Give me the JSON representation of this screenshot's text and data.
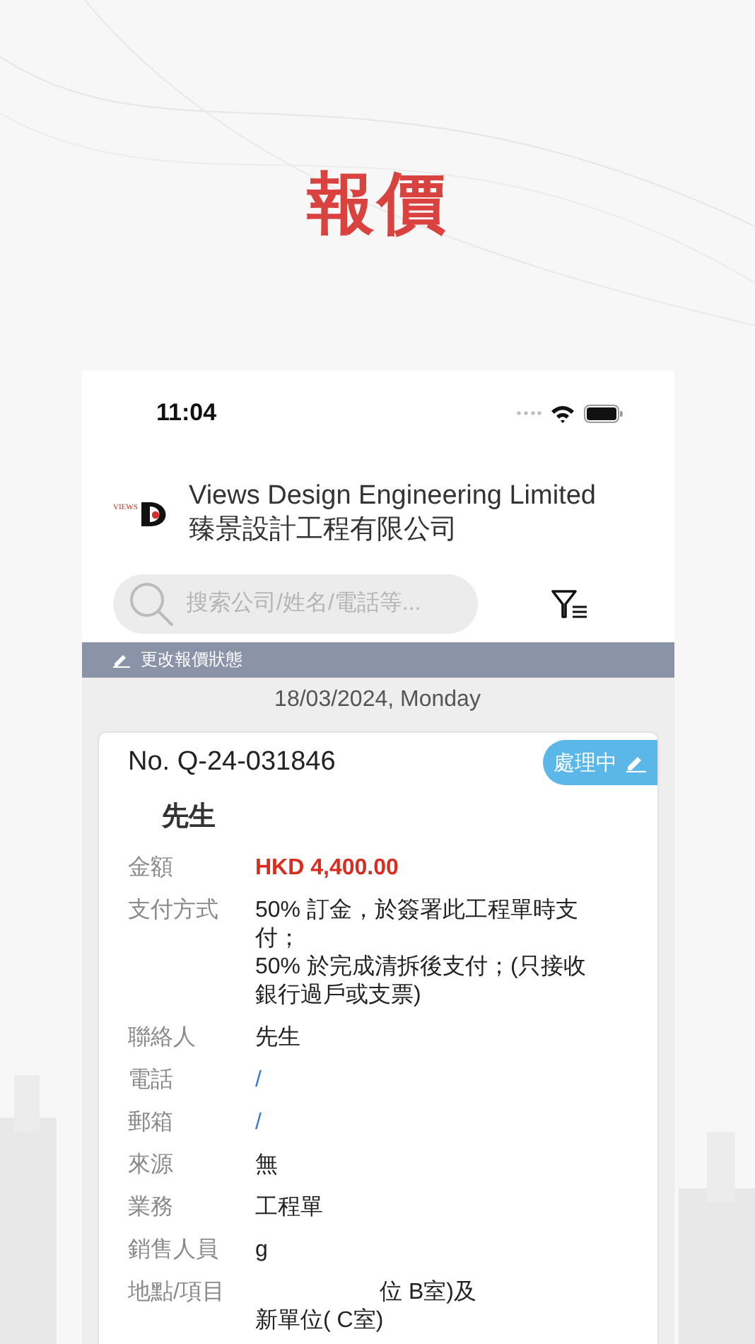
{
  "page_title": "報價",
  "status_bar": {
    "time": "11:04"
  },
  "company": {
    "name_en": "Views Design Engineering Limited",
    "name_zh": "臻景設計工程有限公司",
    "logo_text": "VIEWS"
  },
  "search": {
    "placeholder": "搜索公司/姓名/電話等..."
  },
  "action_bar": {
    "label": "更改報價狀態"
  },
  "date_header": "18/03/2024, Monday",
  "quote": {
    "number": "No. Q-24-031846",
    "status": "處理中",
    "customer": "先生",
    "fields": [
      {
        "label": "金額",
        "value": "HKD 4,400.00",
        "kind": "amount"
      },
      {
        "label": "支付方式",
        "value": "50% 訂金，於簽署此工程單時支付；\n50% 於完成清拆後支付；(只接收銀行過戶或支票)",
        "kind": "text"
      },
      {
        "label": "聯絡人",
        "value": "先生",
        "kind": "text"
      },
      {
        "label": "電話",
        "value": "/",
        "kind": "link"
      },
      {
        "label": "郵箱",
        "value": "/",
        "kind": "link"
      },
      {
        "label": "來源",
        "value": "無",
        "kind": "text"
      },
      {
        "label": "業務",
        "value": "工程單",
        "kind": "text"
      },
      {
        "label": "銷售人員",
        "value": "g",
        "kind": "text"
      },
      {
        "label": "地點/項目",
        "lines": [
          "位 B室)及",
          "新單位( C室)"
        ],
        "kind": "text"
      }
    ]
  }
}
